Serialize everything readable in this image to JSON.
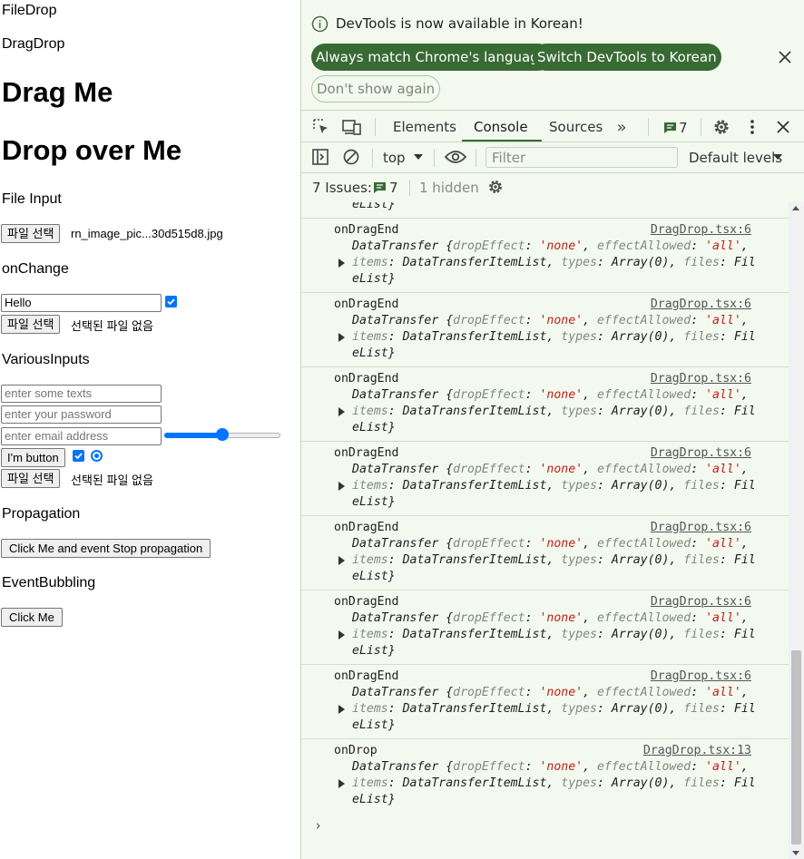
{
  "page": {
    "file_drop": "FileDrop",
    "drag_drop": "DragDrop",
    "drag_me": "Drag Me",
    "drop_over_me": "Drop over Me",
    "file_input": "File Input",
    "file_btn": "파일 선택",
    "file_name": "rn_image_pic...30d515d8.jpg",
    "on_change": "onChange",
    "hello_value": "Hello",
    "no_file": "선택된 파일 없음",
    "various_inputs": "VariousInputs",
    "ph_text": "enter some texts",
    "ph_password": "enter your password",
    "ph_email": "enter email address",
    "slider_value": 50,
    "im_button": "I'm button",
    "propagation": "Propagation",
    "stop_prop_btn": "Click Me and event Stop propagation",
    "event_bubbling": "EventBubbling",
    "click_me": "Click Me"
  },
  "devtools": {
    "notice": "DevTools is now available in Korean!",
    "btn_match": "Always match Chrome's language",
    "btn_switch": "Switch DevTools to Korean",
    "btn_dont_show": "Don't show again",
    "tabs": {
      "elements": "Elements",
      "console": "Console",
      "sources": "Sources"
    },
    "msg_count": "7",
    "context": "top",
    "filter_placeholder": "Filter",
    "levels": "Default levels",
    "issues_label": "7 Issues:",
    "issues_count": "7",
    "hidden": "1 hidden",
    "partial_top": "eList}",
    "entries": [
      {
        "name": "onDragEnd",
        "src": "DragDrop.tsx:6"
      },
      {
        "name": "onDragEnd",
        "src": "DragDrop.tsx:6"
      },
      {
        "name": "onDragEnd",
        "src": "DragDrop.tsx:6"
      },
      {
        "name": "onDragEnd",
        "src": "DragDrop.tsx:6"
      },
      {
        "name": "onDragEnd",
        "src": "DragDrop.tsx:6"
      },
      {
        "name": "onDragEnd",
        "src": "DragDrop.tsx:6"
      },
      {
        "name": "onDragEnd",
        "src": "DragDrop.tsx:6"
      },
      {
        "name": "onDrop",
        "src": "DragDrop.tsx:13"
      }
    ],
    "dt_parts": {
      "a": "DataTransfer {",
      "k1": "dropEffect",
      "v1": "'none'",
      "k2": "effectAllowed",
      "v2": "'all'",
      "k3": "items",
      "v3": "DataTransferItemList",
      "k4": "types",
      "v4": "Array(0)",
      "k5": "files",
      "v5": "Fil",
      "l3": "eList}"
    },
    "colors": {
      "accent": "#386a34",
      "bg": "#f3f9ef",
      "string": "#c0201a",
      "checkbox": "#0075ff"
    }
  }
}
